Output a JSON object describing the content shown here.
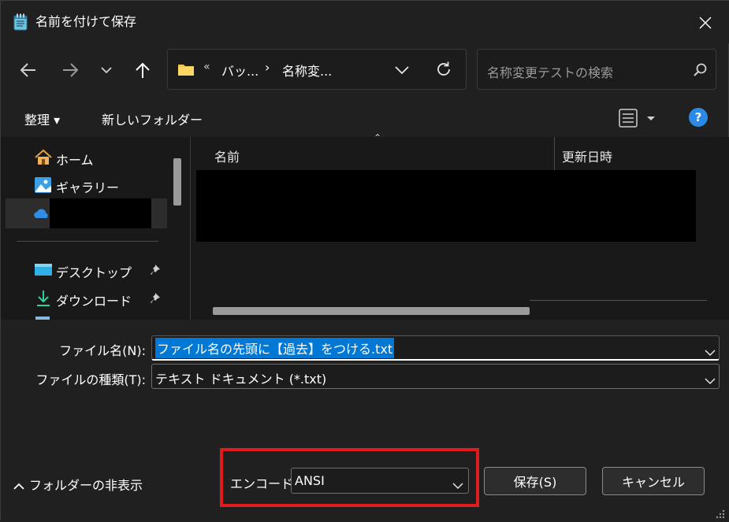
{
  "window": {
    "title": "名前を付けて保存"
  },
  "nav": {
    "address": {
      "overflow_marker": "«",
      "crumbs": [
        "バッ...",
        "名称変..."
      ],
      "separator": "›"
    },
    "search_placeholder": "名称変更テストの検索"
  },
  "command_bar": {
    "organize_label": "整理 ▾",
    "new_folder_label": "新しいフォルダー",
    "help_label": "?"
  },
  "sidebar": {
    "items": [
      {
        "label": "ホーム",
        "icon": "home-icon"
      },
      {
        "label": "ギャラリー",
        "icon": "gallery-icon"
      },
      {
        "label": "",
        "icon": "onedrive-icon"
      },
      {
        "label": "デスクトップ",
        "icon": "desktop-icon",
        "pinned": true
      },
      {
        "label": "ダウンロード",
        "icon": "download-icon",
        "pinned": true
      }
    ]
  },
  "file_list": {
    "columns": [
      "名前",
      "更新日時"
    ]
  },
  "form": {
    "filename_label": "ファイル名(N):",
    "filename_value": "ファイル名の先頭に【過去】をつける.txt",
    "filetype_label": "ファイルの種類(T):",
    "filetype_value": "テキスト ドキュメント (*.txt)",
    "hide_folders_label": "フォルダーの非表示",
    "encoding_label": "エンコード:",
    "encoding_value": "ANSI",
    "save_label": "保存(S)",
    "cancel_label": "キャンセル"
  },
  "colors": {
    "background": "#202020",
    "pane": "#191919",
    "accent": "#0078d4",
    "highlight_box": "#e01b1b",
    "help": "#2a8ae6"
  }
}
